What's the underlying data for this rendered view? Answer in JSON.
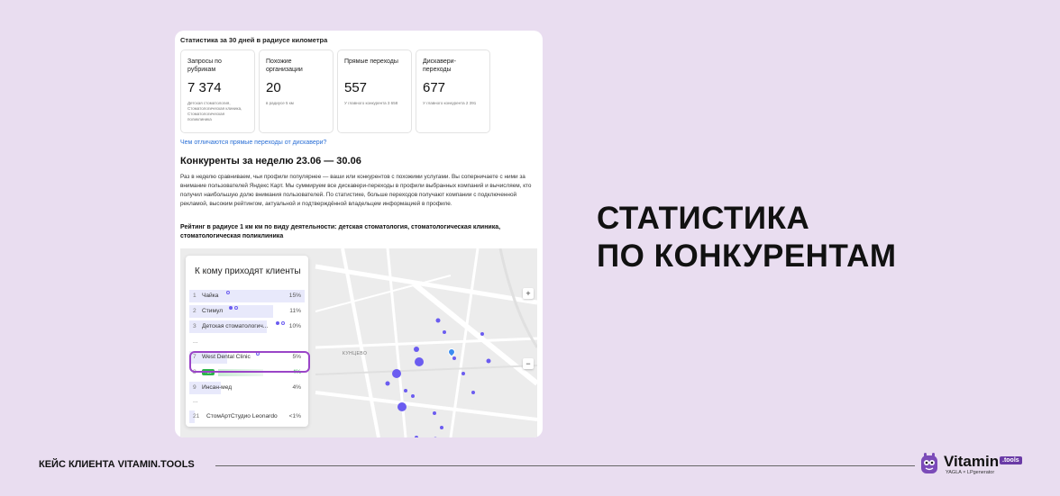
{
  "card": {
    "stats_title": "Статистика за 30 дней в радиусе километра",
    "tiles": [
      {
        "label": "Запросы по рубрикам",
        "value": "7 374",
        "note": "Детская стоматология, Стоматологическая клиника, Стоматологическая поликлиника"
      },
      {
        "label": "Похожие организации",
        "value": "20",
        "note": "в радиусе 5 км"
      },
      {
        "label": "Прямые переходы",
        "value": "557",
        "note": "У главного конкурента 3 658"
      },
      {
        "label": "Дискавери-переходы",
        "value": "677",
        "note": "У главного конкурента 2 391"
      }
    ],
    "link": "Чем отличаются прямые переходы от дискавери?",
    "heading": "Конкуренты за неделю 23.06 — 30.06",
    "paragraph": "Раз в неделю сравниваем, чьи профили популярнее — ваши или конкурентов с похожими услугами. Вы соперничаете с ними за внимание пользователей Яндекс Карт. Мы суммируем все дискавери-переходы в профили выбранных компаний и вычисляем, кто получил наибольшую долю внимания пользователей. По статистике, больше переходов получают компании с подключенной рекламой, высоким рейтингом, актуальной и подтверждённой владельцем информацией в профиле.",
    "rating": "Рейтинг в радиусе 1 км км по виду деятельности: детская стоматология, стоматологическая клиника, стоматологическая поликлиника"
  },
  "map": {
    "panel_title": "К кому приходят клиенты",
    "rows": [
      {
        "num": "1",
        "name": "Чайка",
        "pct": "15%",
        "share": 1.0
      },
      {
        "num": "2",
        "name": "Стимул",
        "pct": "11%",
        "share": 0.73
      },
      {
        "num": "3",
        "name": "Детская стоматологич...",
        "pct": "10%",
        "share": 0.67
      },
      {
        "num": "...",
        "name": "",
        "pct": "",
        "share": 0
      },
      {
        "num": "7",
        "name": "West Dental Clinic",
        "pct": "5%",
        "share": 0.33
      },
      {
        "num": "8",
        "name": "",
        "pct": "4%",
        "share": 0,
        "badge": "+14"
      },
      {
        "num": "9",
        "name": "Инсан-мед",
        "pct": "4%",
        "share": 0.27
      },
      {
        "num": "...",
        "name": "",
        "pct": "",
        "share": 0
      },
      {
        "num": "21",
        "name": "СтомАртСтудио Leonardo",
        "pct": "<1%",
        "share": 0.05
      }
    ],
    "district": "КУНЦЕВО",
    "zoom_in": "+",
    "zoom_out": "−"
  },
  "headline": {
    "line1": "СТАТИСТИКА",
    "line2": "ПО КОНКУРЕНТАМ"
  },
  "footer": {
    "label": "КЕЙС КЛИЕНТА VITAMIN.TOOLS"
  },
  "logo": {
    "word": "Vitamin",
    "badge": ".tools",
    "sub": "YAGLA × LPgenerator"
  },
  "colors": {
    "background": "#e9ddf0",
    "accent": "#9a45c7",
    "dot": "#6b5cf0",
    "green": "#2bb34a",
    "link": "#2a6fd6"
  }
}
